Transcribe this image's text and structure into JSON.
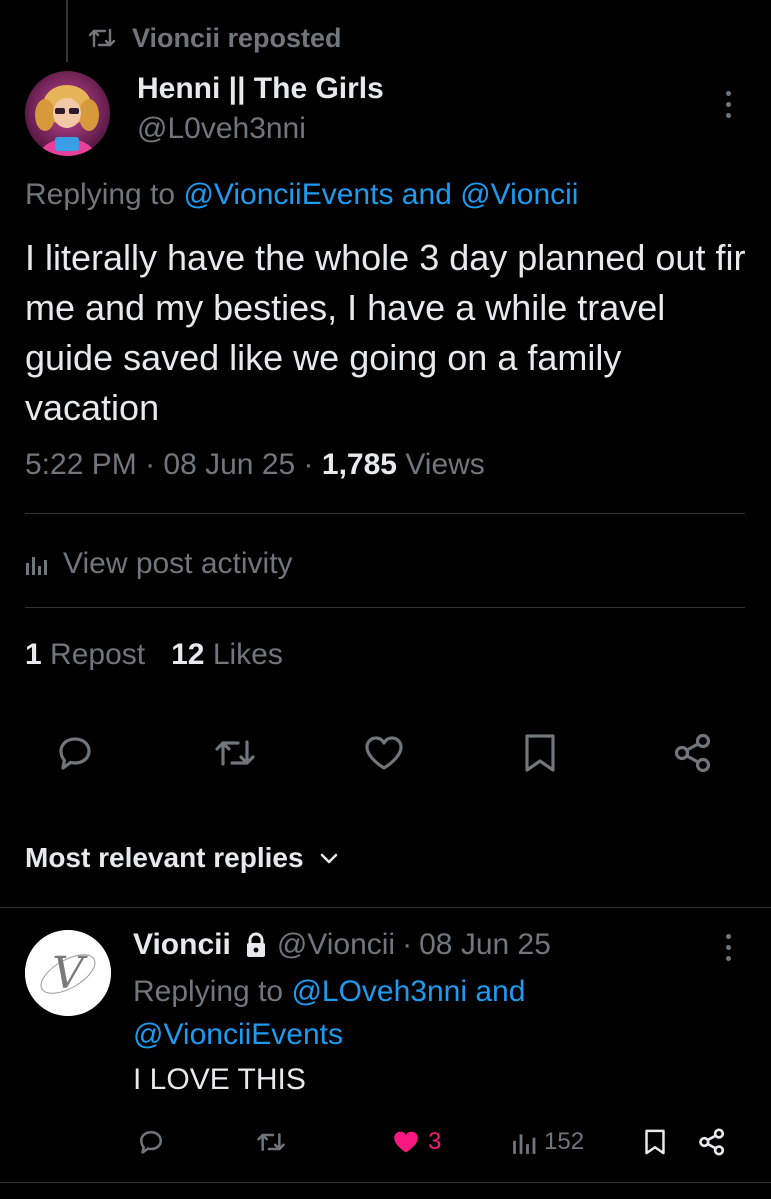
{
  "repost": {
    "label": "Vioncii reposted"
  },
  "post": {
    "author_name": "Henni || The Girls",
    "author_handle": "@L0veh3nni",
    "replying_prefix": "Replying to",
    "replying_user1": "@VionciiEvents",
    "replying_and": "and",
    "replying_user2": "@Vioncii",
    "text": "I literally have the whole 3 day planned out fir me and my besties, I have a while travel guide saved like we going on a family vacation",
    "time": "5:22 PM",
    "date": "08 Jun 25",
    "sep": "·",
    "views_count": "1,785",
    "views_label": "Views",
    "activity_label": "View post activity",
    "reposts_count": "1",
    "reposts_label": "Repost",
    "likes_count": "12",
    "likes_label": "Likes"
  },
  "replies_header": {
    "label": "Most relevant replies"
  },
  "reply": {
    "author_name": "Vioncii",
    "author_handle": "@Vioncii",
    "sep": "·",
    "date": "08 Jun 25",
    "replying_prefix": "Replying to",
    "replying_user1": "@LOveh3nni",
    "replying_and": "and",
    "replying_user2": "@VionciiEvents",
    "text": "I LOVE THIS",
    "likes": "3",
    "views": "152",
    "avatar_letter": "V"
  },
  "colors": {
    "accent": "#1d9bf0",
    "like_pink": "#f91880",
    "muted": "#71767b",
    "text": "#e7e9ea",
    "divider": "#2f3336",
    "background": "#000000"
  },
  "icons": {
    "repost_header": "repost-icon",
    "more": "more-vertical-icon",
    "activity": "bar-chart-icon",
    "reply": "reply-icon",
    "repost": "repost-icon",
    "like": "heart-icon",
    "bookmark": "bookmark-icon",
    "share": "share-icon",
    "chevron": "chevron-down-icon",
    "lock": "lock-icon",
    "views": "views-icon"
  }
}
